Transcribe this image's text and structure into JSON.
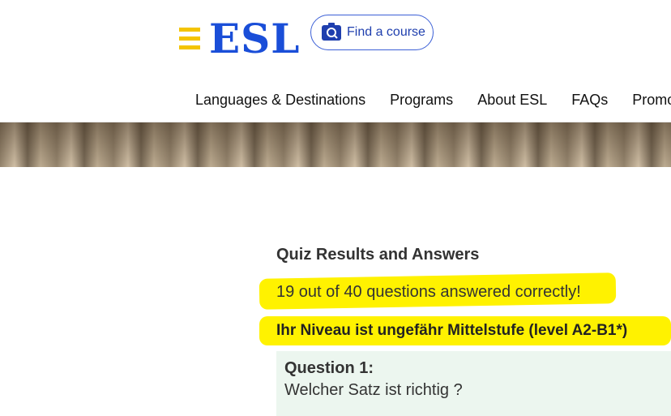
{
  "header": {
    "logo_text": "ESL",
    "find_course_label": "Find a course",
    "nav": [
      "Languages & Destinations",
      "Programs",
      "About ESL",
      "FAQs",
      "Promot"
    ]
  },
  "quiz": {
    "title": "Quiz Results and Answers",
    "score_text": "19 out of 40 questions answered correctly!",
    "level_text": "Ihr Niveau ist ungefähr Mittelstufe (level A2-B1*)",
    "question": {
      "label": "Question 1:",
      "text": "Welcher Satz ist richtig ?"
    }
  },
  "colors": {
    "brand_blue": "#1a4ed8",
    "brand_yellow": "#f4c400",
    "highlight": "#fff200"
  },
  "icons": [
    "menu-icon",
    "search-icon"
  ]
}
